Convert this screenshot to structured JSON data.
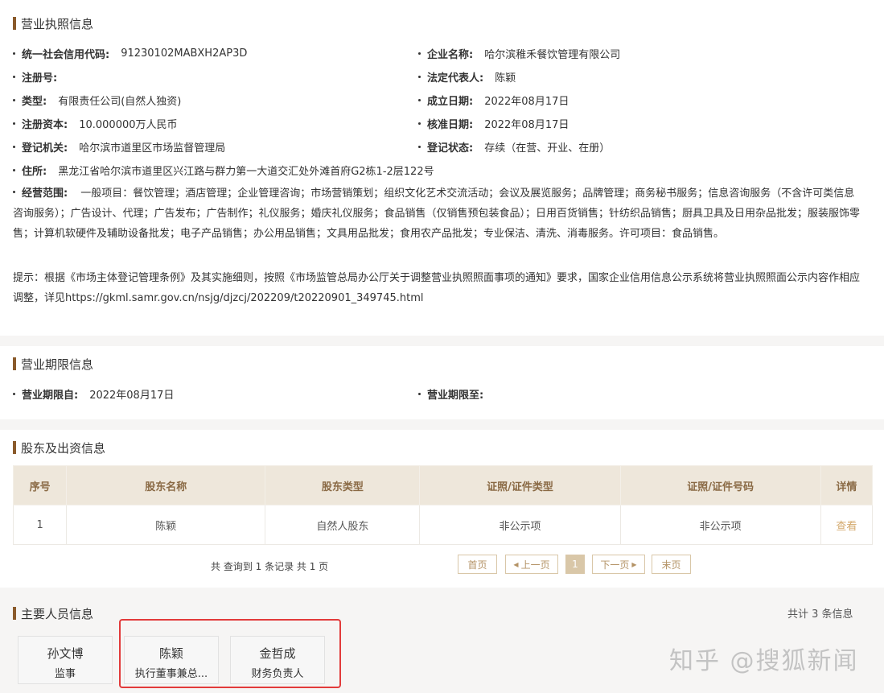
{
  "license": {
    "title": "营业执照信息",
    "credit_code": {
      "label": "统一社会信用代码:",
      "value": "91230102MABXH2AP3D"
    },
    "company_name": {
      "label": "企业名称:",
      "value": "哈尔滨稚禾餐饮管理有限公司"
    },
    "reg_no": {
      "label": "注册号:",
      "value": ""
    },
    "legal_rep": {
      "label": "法定代表人:",
      "value": "陈颖"
    },
    "type": {
      "label": "类型:",
      "value": "有限责任公司(自然人独资)"
    },
    "established": {
      "label": "成立日期:",
      "value": "2022年08月17日"
    },
    "capital": {
      "label": "注册资本:",
      "value": "10.000000万人民币"
    },
    "approved": {
      "label": "核准日期:",
      "value": "2022年08月17日"
    },
    "authority": {
      "label": "登记机关:",
      "value": "哈尔滨市道里区市场监督管理局"
    },
    "status": {
      "label": "登记状态:",
      "value": "存续（在营、开业、在册）"
    },
    "address": {
      "label": "住所:",
      "value": "黑龙江省哈尔滨市道里区兴江路与群力第一大道交汇处外滩首府G2栋1-2层122号"
    },
    "scope": {
      "label": "经营范围:",
      "value": "一般项目：餐饮管理；酒店管理；企业管理咨询；市场营销策划；组织文化艺术交流活动；会议及展览服务；品牌管理；商务秘书服务；信息咨询服务（不含许可类信息咨询服务）；广告设计、代理；广告发布；广告制作；礼仪服务；婚庆礼仪服务；食品销售（仅销售预包装食品）；日用百货销售；针纺织品销售；厨具卫具及日用杂品批发；服装服饰零售；计算机软硬件及辅助设备批发；电子产品销售；办公用品销售；文具用品批发；食用农产品批发；专业保洁、清洗、消毒服务。许可项目：食品销售。"
    },
    "notice": "提示：根据《市场主体登记管理条例》及其实施细则，按照《市场监管总局办公厅关于调整营业执照照面事项的通知》要求，国家企业信用信息公示系统将营业执照照面公示内容作相应调整，详见https://gkml.samr.gov.cn/nsjg/djzcj/202209/t20220901_349745.html"
  },
  "term": {
    "title": "营业期限信息",
    "from": {
      "label": "营业期限自:",
      "value": "2022年08月17日"
    },
    "to": {
      "label": "营业期限至:",
      "value": ""
    }
  },
  "shareholders": {
    "title": "股东及出资信息",
    "headers": [
      "序号",
      "股东名称",
      "股东类型",
      "证照/证件类型",
      "证照/证件号码",
      "详情"
    ],
    "rows": [
      [
        "1",
        "陈颖",
        "自然人股东",
        "非公示项",
        "非公示项",
        "查看"
      ]
    ],
    "pager_info": "共 查询到 1 条记录 共 1 页",
    "pager": {
      "first": "首页",
      "prev": "上一页",
      "current": "1",
      "next": "下一页",
      "last": "末页"
    }
  },
  "personnel": {
    "title": "主要人员信息",
    "count": "共计 3 条信息",
    "people": [
      {
        "name": "孙文博",
        "position": "监事"
      },
      {
        "name": "陈颖",
        "position": "执行董事兼总..."
      },
      {
        "name": "金哲成",
        "position": "财务负责人"
      }
    ]
  },
  "watermark": "知乎 @搜狐新闻",
  "colors": {
    "accent": "#8a5a2b",
    "table_header": "#eee7db",
    "highlight_box": "#e23b3b",
    "link": "#d3a86b"
  }
}
